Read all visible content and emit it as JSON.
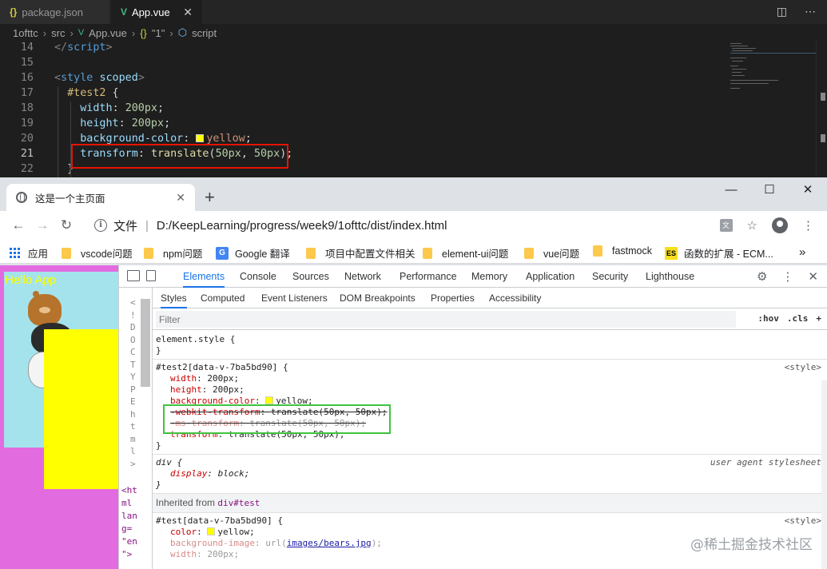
{
  "vscode": {
    "tabs": [
      {
        "icon": "{}",
        "label": "package.json",
        "active": false
      },
      {
        "icon": "V",
        "label": "App.vue",
        "active": true,
        "close": "✕"
      }
    ],
    "breadcrumb": [
      "1ofttc",
      "src",
      "App.vue",
      "{}",
      "\"1\"",
      "script"
    ],
    "lines": [
      {
        "n": "14",
        "segments": [
          {
            "t": "</",
            "c": "tag"
          },
          {
            "t": "script",
            "c": "tname"
          },
          {
            "t": ">",
            "c": "tag"
          }
        ]
      },
      {
        "n": "15",
        "segments": []
      },
      {
        "n": "16",
        "segments": [
          {
            "t": "<",
            "c": "tag"
          },
          {
            "t": "style",
            "c": "tname"
          },
          {
            "t": " ",
            "c": ""
          },
          {
            "t": "scoped",
            "c": "attr"
          },
          {
            "t": ">",
            "c": "tag"
          }
        ]
      },
      {
        "n": "17",
        "segments": [
          {
            "t": "  ",
            "c": ""
          },
          {
            "t": "#test2",
            "c": "sel"
          },
          {
            "t": " {",
            "c": ""
          }
        ]
      },
      {
        "n": "18",
        "segments": [
          {
            "t": "    ",
            "c": ""
          },
          {
            "t": "width",
            "c": "prop"
          },
          {
            "t": ": ",
            "c": ""
          },
          {
            "t": "200px",
            "c": "num"
          },
          {
            "t": ";",
            "c": ""
          }
        ]
      },
      {
        "n": "19",
        "segments": [
          {
            "t": "    ",
            "c": ""
          },
          {
            "t": "height",
            "c": "prop"
          },
          {
            "t": ": ",
            "c": ""
          },
          {
            "t": "200px",
            "c": "num"
          },
          {
            "t": ";",
            "c": ""
          }
        ]
      },
      {
        "n": "20",
        "segments": [
          {
            "t": "    ",
            "c": ""
          },
          {
            "t": "background-color",
            "c": "prop"
          },
          {
            "t": ": ",
            "c": ""
          },
          {
            "t": "",
            "c": "swatch"
          },
          {
            "t": "yellow",
            "c": "val"
          },
          {
            "t": ";",
            "c": ""
          }
        ]
      },
      {
        "n": "21",
        "segments": [
          {
            "t": "    ",
            "c": ""
          },
          {
            "t": "transform",
            "c": "prop"
          },
          {
            "t": ": ",
            "c": ""
          },
          {
            "t": "translate",
            "c": "fn"
          },
          {
            "t": "(",
            "c": ""
          },
          {
            "t": "50px",
            "c": "num"
          },
          {
            "t": ", ",
            "c": ""
          },
          {
            "t": "50px",
            "c": "num"
          },
          {
            "t": ");",
            "c": ""
          }
        ],
        "active": true
      },
      {
        "n": "22",
        "segments": [
          {
            "t": "  }",
            "c": ""
          }
        ]
      }
    ]
  },
  "chrome": {
    "tab_title": "这是一个主页面",
    "tab_close": "✕",
    "new_tab": "+",
    "win_min": "—",
    "win_max": "☐",
    "win_close": "✕",
    "back": "←",
    "forward": "→",
    "reload": "↻",
    "info_icon": "i",
    "file_label": "文件",
    "divider": "|",
    "url": "D:/KeepLearning/progress/week9/1ofttc/dist/index.html",
    "star": "☆",
    "menu": "⋮",
    "bookmarks": {
      "apps": "应用",
      "items": [
        "vscode问题",
        "npm问题",
        "Google 翻译",
        "项目中配置文件相关",
        "element-ui问题",
        "vue问题",
        "fastmock",
        "函数的扩展 - ECM..."
      ],
      "more": "»"
    }
  },
  "page": {
    "hello": "Hello App"
  },
  "devtools": {
    "tabs": [
      "Elements",
      "Console",
      "Sources",
      "Network",
      "Performance",
      "Memory",
      "Application",
      "Security",
      "Lighthouse"
    ],
    "selected_tab": "Elements",
    "gear": "⚙",
    "more": "⋮",
    "close": "✕",
    "elem_chars": [
      "<",
      "!",
      "D",
      "O",
      "C",
      "T",
      "Y",
      "P",
      "E",
      "h",
      "t",
      "m",
      "l",
      ">"
    ],
    "elem_bottom": "<ht\nml\nlan\ng=\n\"en\n\">",
    "sub_tabs": [
      "Styles",
      "Computed",
      "Event Listeners",
      "DOM Breakpoints",
      "Properties",
      "Accessibility"
    ],
    "filter_placeholder": "Filter",
    "hov": ":hov",
    "cls": ".cls",
    "plus": "+",
    "element_style": {
      "open": "element.style {",
      "close": "}"
    },
    "rule_test2": {
      "selector": "#test2[data-v-7ba5bd90] {",
      "source": "<style>",
      "props": [
        {
          "name": "width",
          "value": "200px;"
        },
        {
          "name": "height",
          "value": "200px;"
        },
        {
          "name": "background-color",
          "value": "yellow;",
          "swatch": "#ffff00"
        },
        {
          "name": "-webkit-transform",
          "value": "translate(50px, 50px);",
          "struck": true
        },
        {
          "name": "-ms-transform",
          "value": "translate(50px, 50px);",
          "struck": true,
          "dim": true
        },
        {
          "name": "transform",
          "value": "translate(50px, 50px);"
        }
      ],
      "close": "}"
    },
    "rule_div": {
      "selector": "div {",
      "source": "user agent stylesheet",
      "prop": "display",
      "value": "block;",
      "close": "}"
    },
    "inherited_label": "Inherited from",
    "inherited_tag": "div#test",
    "rule_test": {
      "selector": "#test[data-v-7ba5bd90] {",
      "source": "<style>",
      "color_name": "color",
      "color_value": "yellow;",
      "bg_name": "background-image",
      "bg_prefix": "url(",
      "bg_link": "images/bears.jpg",
      "bg_suffix": ");",
      "width_name": "width",
      "width_value": "200px;"
    }
  },
  "watermark": "@稀土掘金技术社区"
}
